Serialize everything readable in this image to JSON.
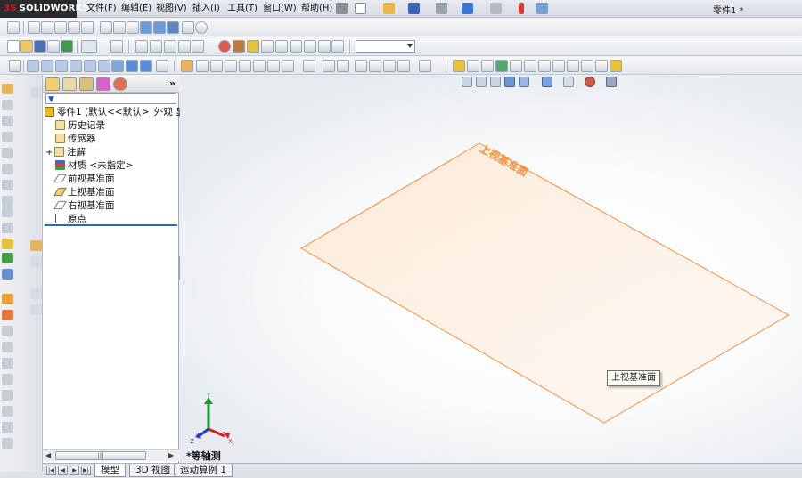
{
  "app": {
    "logo_brand": "SOLIDWORKS",
    "logo_prefix": "3S",
    "window_title": "零件1 *"
  },
  "menu": [
    {
      "label": "文件(F)"
    },
    {
      "label": "编辑(E)"
    },
    {
      "label": "视图(V)"
    },
    {
      "label": "插入(I)"
    },
    {
      "label": "工具(T)"
    },
    {
      "label": "窗口(W)"
    },
    {
      "label": "帮助(H)"
    }
  ],
  "feature_manager": {
    "expand_label": "»",
    "filter_icon": "▼",
    "tabs": [
      {
        "icon": "feature-manager-tab-icon"
      },
      {
        "icon": "property-manager-tab-icon"
      },
      {
        "icon": "configuration-manager-tab-icon"
      },
      {
        "icon": "dimxpert-tab-icon"
      },
      {
        "icon": "display-manager-tab-icon"
      }
    ],
    "tree": [
      {
        "label": "零件1 (默认<<默认>_外观 显",
        "icon": "part-icon"
      },
      {
        "label": "历史记录",
        "icon": "history-icon"
      },
      {
        "label": "传感器",
        "icon": "sensor-icon"
      },
      {
        "label": "注解",
        "icon": "annotations-icon"
      },
      {
        "label": "材质 <未指定>",
        "icon": "material-icon"
      },
      {
        "label": "前视基准面",
        "icon": "plane-icon"
      },
      {
        "label": "上视基准面",
        "icon": "plane-icon"
      },
      {
        "label": "右视基准面",
        "icon": "plane-icon"
      },
      {
        "label": "原点",
        "icon": "origin-icon"
      }
    ],
    "expander": "+",
    "scrollbar_grip": "|||"
  },
  "graphics": {
    "plane_label": "上视基准面",
    "tooltip": "上视基准面",
    "view_orientation": "*等轴测",
    "triad": {
      "x": "X",
      "y": "Y",
      "z": "Z"
    },
    "plane_color": "#f0903a"
  },
  "bottom_tabs": [
    {
      "label": "模型",
      "active": true
    },
    {
      "label": "3D 视图",
      "active": false
    },
    {
      "label": "运动算例 1",
      "active": false
    }
  ],
  "nav_arrows": [
    "|◀",
    "◀",
    "▶",
    "▶|"
  ]
}
